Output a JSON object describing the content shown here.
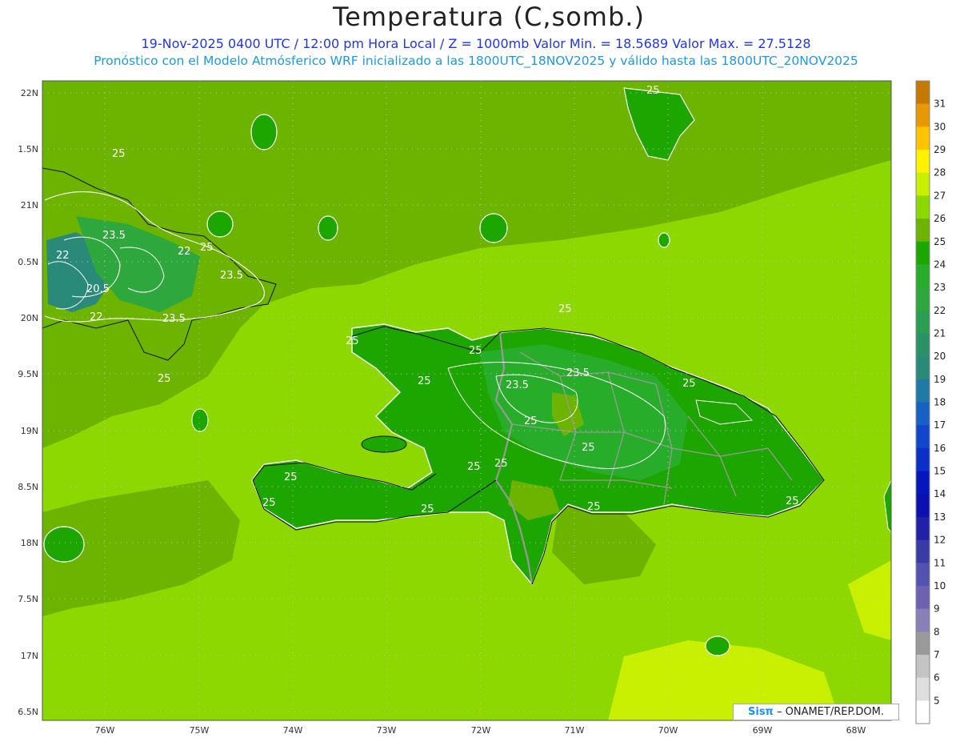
{
  "header": {
    "title": "Temperatura (C,somb.)",
    "line1": "19-Nov-2025 0400 UTC / 12:00 pm Hora Local / Z = 1000mb  Valor Min. = 18.5689  Valor Max. = 27.5128",
    "line2": "Pronóstico con el Modelo Atmósferico WRF inicializado a las 1800UTC_18NOV2025 y válido hasta las  1800UTC_20NOV2025"
  },
  "axes": {
    "lat_labels": [
      "22N",
      "1.5N",
      "21N",
      "0.5N",
      "20N",
      "9.5N",
      "19N",
      "8.5N",
      "18N",
      "7.5N",
      "17N",
      "6.5N"
    ],
    "lon_labels": [
      "76W",
      "75W",
      "74W",
      "73W",
      "72W",
      "71W",
      "70W",
      "69W",
      "68W"
    ]
  },
  "colorbar": {
    "labels": [
      "31",
      "30",
      "29",
      "28",
      "27",
      "26",
      "25",
      "24",
      "23",
      "22",
      "21",
      "20",
      "19",
      "18",
      "17",
      "16",
      "15",
      "14",
      "13",
      "12",
      "11",
      "10",
      "9",
      "8",
      "7",
      "6",
      "5"
    ],
    "colors": [
      "#c47a00",
      "#e89800",
      "#ffc400",
      "#fff200",
      "#c8f000",
      "#8cd800",
      "#6cb400",
      "#1ea600",
      "#28ad2a",
      "#2ea83c",
      "#2c9e52",
      "#2a9066",
      "#2a8a7a",
      "#1f7aa6",
      "#1760c4",
      "#1246cc",
      "#0a30c8",
      "#0616be",
      "#0c10b0",
      "#2020a8",
      "#3a3aa8",
      "#5252b0",
      "#6e62b0",
      "#8a80b8",
      "#9a9a9a",
      "#c4c4c4",
      "#dedede",
      "#ffffff"
    ]
  },
  "contour_labels": [
    {
      "text": "25"
    },
    {
      "text": "25"
    },
    {
      "text": "23.5"
    },
    {
      "text": "22"
    },
    {
      "text": "22"
    },
    {
      "text": "25"
    },
    {
      "text": "23.5"
    },
    {
      "text": "20.5"
    },
    {
      "text": "22"
    },
    {
      "text": "23.5"
    },
    {
      "text": "25"
    },
    {
      "text": "25"
    },
    {
      "text": "25"
    },
    {
      "text": "25"
    },
    {
      "text": "23.5"
    },
    {
      "text": "23.5"
    },
    {
      "text": "25"
    },
    {
      "text": "25"
    },
    {
      "text": "25"
    },
    {
      "text": "25"
    },
    {
      "text": "25"
    },
    {
      "text": "25"
    },
    {
      "text": "25"
    },
    {
      "text": "25"
    },
    {
      "text": "25"
    },
    {
      "text": "25"
    },
    {
      "text": "25"
    }
  ],
  "credit": {
    "brand": "Sisπ",
    "text": " – ONAMET/REP.DOM."
  },
  "colors": {
    "sea_base": "#8cd800",
    "land_main": "#1ea600",
    "land_mid": "#6cb400",
    "highlight": "#c8f000"
  }
}
